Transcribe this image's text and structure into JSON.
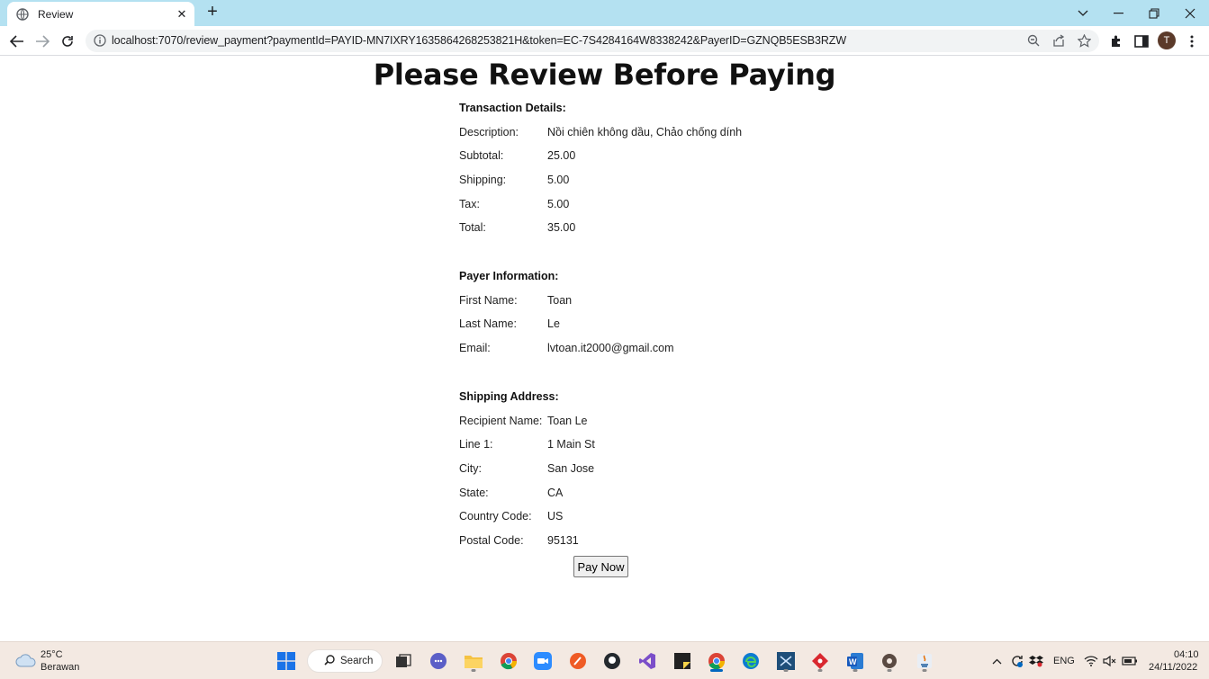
{
  "browser": {
    "tab_title": "Review",
    "url": "localhost:7070/review_payment?paymentId=PAYID-MN7IXRY1635864268253821H&token=EC-7S4284164W8338242&PayerID=GZNQB5ESB3RZW",
    "profile_initial": "T"
  },
  "page": {
    "title": "Please Review Before Paying",
    "transaction": {
      "heading": "Transaction Details:",
      "rows": [
        {
          "label": "Description:",
          "value": "Nồi chiên không dầu, Chảo chống dính"
        },
        {
          "label": "Subtotal:",
          "value": "25.00"
        },
        {
          "label": "Shipping:",
          "value": "5.00"
        },
        {
          "label": "Tax:",
          "value": "5.00"
        },
        {
          "label": "Total:",
          "value": "35.00"
        }
      ]
    },
    "payer": {
      "heading": "Payer Information:",
      "rows": [
        {
          "label": "First Name:",
          "value": "Toan"
        },
        {
          "label": "Last Name:",
          "value": "Le"
        },
        {
          "label": "Email:",
          "value": "lvtoan.it2000@gmail.com"
        }
      ]
    },
    "shipping": {
      "heading": "Shipping Address:",
      "rows": [
        {
          "label": "Recipient Name:",
          "value": "Toan Le"
        },
        {
          "label": "Line 1:",
          "value": "1 Main St"
        },
        {
          "label": "City:",
          "value": "San Jose"
        },
        {
          "label": "State:",
          "value": "CA"
        },
        {
          "label": "Country Code:",
          "value": "US"
        },
        {
          "label": "Postal Code:",
          "value": "95131"
        }
      ]
    },
    "pay_button": "Pay Now"
  },
  "taskbar": {
    "weather_temp": "25°C",
    "weather_desc": "Berawan",
    "search_label": "Search",
    "language": "ENG",
    "time": "04:10",
    "date": "24/11/2022"
  }
}
